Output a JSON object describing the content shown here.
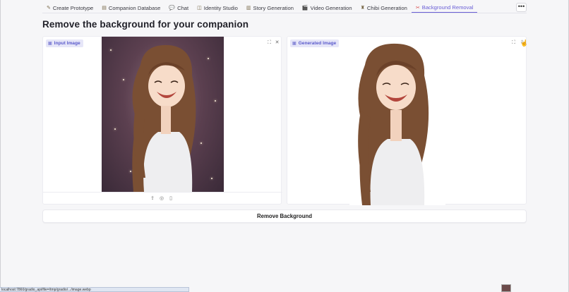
{
  "tabs": [
    {
      "icon": "✎",
      "label": "Create Prototype"
    },
    {
      "icon": "▤",
      "label": "Companion Database"
    },
    {
      "icon": "💬",
      "label": "Chat"
    },
    {
      "icon": "◫",
      "label": "Identity Studio"
    },
    {
      "icon": "▥",
      "label": "Story Generation"
    },
    {
      "icon": "🎬",
      "label": "Video Generation"
    },
    {
      "icon": "♜",
      "label": "Chibi Generation"
    },
    {
      "icon": "✂",
      "label": "Background Removal"
    }
  ],
  "more_label": "•••",
  "page_title": "Remove the background for your companion",
  "input_panel": {
    "label": "Input Image"
  },
  "output_panel": {
    "label": "Generated Image"
  },
  "remove_button": "Remove Background",
  "status_url": "localhost:7860/gradio_api/file=/tmp/gradio/.../image.webp"
}
